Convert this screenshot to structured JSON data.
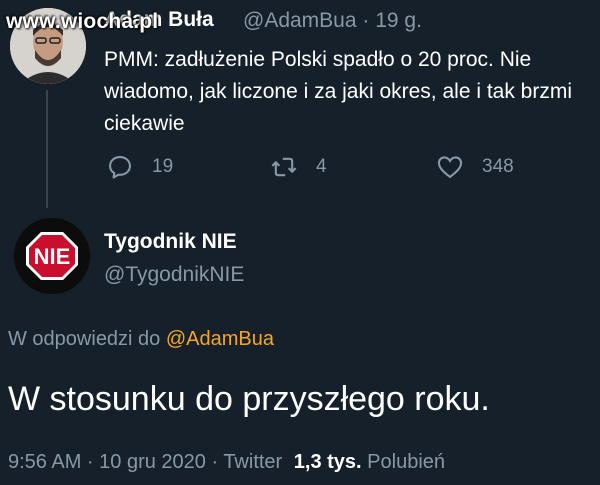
{
  "watermark": "www.wiocha.pl",
  "tweet1": {
    "author_name": "Adam Buła",
    "handle_time": "@AdamBua · 19 g.",
    "text": "PMM: zadłużenie Polski spadło o 20 proc. Nie wiadomo, jak liczone i za jaki okres, ale i tak brzmi ciekawie",
    "reply_count": "19",
    "retweet_count": "4",
    "like_count": "348"
  },
  "tweet2": {
    "author_name": "Tygodnik NIE",
    "handle": "@TygodnikNIE",
    "avatar_text": "NIE",
    "reply_prefix": "W odpowiedzi do",
    "reply_mention": "@AdamBua",
    "text": "W stosunku do przyszłego roku.",
    "timestamp": "9:56 AM · 10 gru 2020 · Twitter",
    "likes_count": "1,3 tys.",
    "likes_label": "Polubień"
  },
  "colors": {
    "background": "#15202b",
    "secondary_text": "#8899a6",
    "mention": "#f5a623",
    "stop_sign_red": "#c8102e"
  }
}
